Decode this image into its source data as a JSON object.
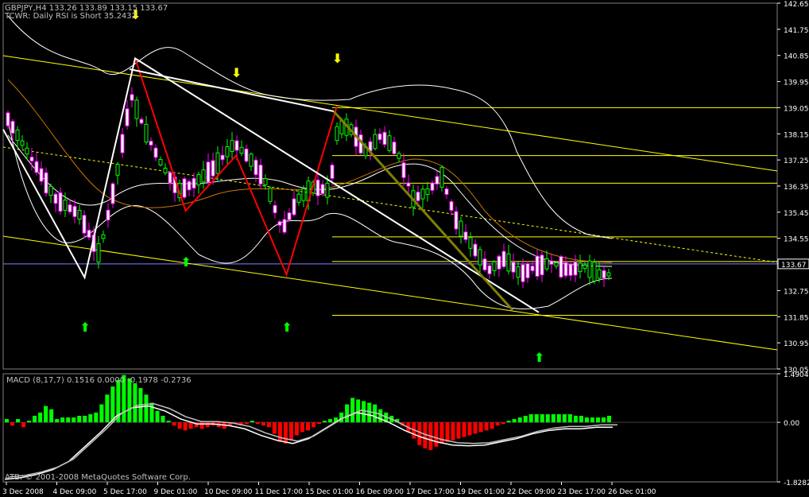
{
  "window": {
    "symbol_line": "GBPJPY,H4  133.26 133.89 133.15 133.67",
    "indicator_line": "TCWR: Daily RSI is Short 35.2432",
    "macd_line": "MACD  (8,17,7) 0.1516 0.0000 -0.1978 -0.2736",
    "copyright": "ATB. © 2001-2008 MetaQuotes Software Corp."
  },
  "colors": {
    "background": "#000000",
    "bull_candle": "#00ff00",
    "bear_candle_body": "#ffffff",
    "bear_candle_wick": "#ff00ff",
    "support_lines": "#ffff00",
    "bands": "#ffffff",
    "zigzag_red": "#ff0000",
    "zigzag_white": "#ffffff",
    "trend_olive": "#808000",
    "ma_orange": "#cc7700",
    "macd_up": "#00ff00",
    "macd_down": "#ff0000",
    "axis_text": "#ffffff",
    "frame": "#808080"
  },
  "chart_data": [
    {
      "type": "candlestick",
      "title": "GBPJPY,H4",
      "price_axis": {
        "ticks": [
          "142.65",
          "141.75",
          "140.85",
          "139.95",
          "139.05",
          "138.15",
          "137.25",
          "136.35",
          "135.45",
          "134.55",
          "133.67",
          "132.75",
          "131.85",
          "130.95",
          "130.05"
        ],
        "current_price": "133.67",
        "ylim": [
          130.05,
          142.65
        ]
      },
      "time_axis": {
        "ticks": [
          "3 Dec 2008",
          "4 Dec 09:00",
          "5 Dec 17:00",
          "9 Dec 01:00",
          "10 Dec 09:00",
          "11 Dec 17:00",
          "15 Dec 01:00",
          "16 Dec 09:00",
          "17 Dec 17:00",
          "19 Dec 01:00",
          "22 Dec 09:00",
          "23 Dec 17:00",
          "26 Dec 01:00"
        ]
      },
      "horizontal_levels": [
        139.05,
        137.4,
        136.45,
        134.6,
        133.75,
        131.9
      ],
      "zigzag_red": [
        {
          "x": "5 Dec 17:00",
          "y": 140.75
        },
        {
          "x": "9 Dec 01:00",
          "y": 135.5
        },
        {
          "x": "10 Dec 09:00",
          "y": 137.4
        },
        {
          "x": "11 Dec 17:00",
          "y": 133.3
        },
        {
          "x": "15 Dec 01:00",
          "y": 139.1
        }
      ],
      "zigzag_white": [
        {
          "x": "3 Dec 2008",
          "y": 138.3
        },
        {
          "x": "4 Dec 09:00",
          "y": 133.2
        },
        {
          "x": "5 Dec 17:00",
          "y": 140.75
        },
        {
          "x": "22 Dec 09:00",
          "y": 132.0
        }
      ],
      "arrows_down_yellow": [
        "5 Dec 17:00",
        "10 Dec 09:00",
        "15 Dec 01:00"
      ],
      "arrows_up_green": [
        "4 Dec 09:00",
        "9 Dec 01:00",
        "11 Dec 17:00",
        "22 Dec 09:00"
      ]
    },
    {
      "type": "bar",
      "title": "MACD (8,17,7)",
      "axis": {
        "ticks": [
          "1.4904",
          "0.00",
          "-1.8282"
        ],
        "ylim": [
          -1.8282,
          1.4904
        ]
      },
      "values": [
        0.1,
        -0.1,
        0.1,
        -0.15,
        0.05,
        0.2,
        0.3,
        0.5,
        0.4,
        0.1,
        0.15,
        0.15,
        0.15,
        0.2,
        0.2,
        0.25,
        0.3,
        0.55,
        0.85,
        1.1,
        1.3,
        1.45,
        1.35,
        1.2,
        1.05,
        0.85,
        0.6,
        0.35,
        0.2,
        0.05,
        -0.1,
        -0.2,
        -0.25,
        -0.2,
        -0.15,
        -0.2,
        -0.15,
        -0.1,
        -0.15,
        -0.2,
        -0.1,
        -0.05,
        -0.1,
        -0.05,
        0.05,
        -0.05,
        -0.1,
        -0.15,
        -0.35,
        -0.6,
        -0.65,
        -0.55,
        -0.4,
        -0.3,
        -0.25,
        -0.15,
        -0.05,
        0.05,
        0.1,
        0.15,
        0.3,
        0.55,
        0.75,
        0.7,
        0.65,
        0.6,
        0.55,
        0.4,
        0.3,
        0.2,
        0.1,
        -0.1,
        -0.3,
        -0.5,
        -0.7,
        -0.8,
        -0.85,
        -0.75,
        -0.65,
        -0.6,
        -0.55,
        -0.5,
        -0.45,
        -0.4,
        -0.35,
        -0.3,
        -0.25,
        -0.2,
        -0.1,
        -0.05,
        0.05,
        0.1,
        0.15,
        0.2,
        0.25,
        0.25,
        0.25,
        0.25,
        0.25,
        0.25,
        0.25,
        0.25,
        0.2,
        0.2,
        0.15,
        0.15,
        0.15,
        0.15,
        0.2
      ],
      "signal_line": [
        -1.75,
        -1.7,
        -1.6,
        -1.45,
        -1.2,
        -0.75,
        -0.3,
        0.2,
        0.45,
        0.5,
        0.35,
        0.1,
        -0.05,
        -0.05,
        -0.1,
        -0.2,
        -0.4,
        -0.55,
        -0.65,
        -0.5,
        -0.2,
        0.1,
        0.3,
        0.2,
        0.0,
        -0.25,
        -0.45,
        -0.6,
        -0.7,
        -0.72,
        -0.7,
        -0.6,
        -0.5,
        -0.35,
        -0.25,
        -0.2,
        -0.2,
        -0.15,
        -0.15
      ]
    }
  ]
}
